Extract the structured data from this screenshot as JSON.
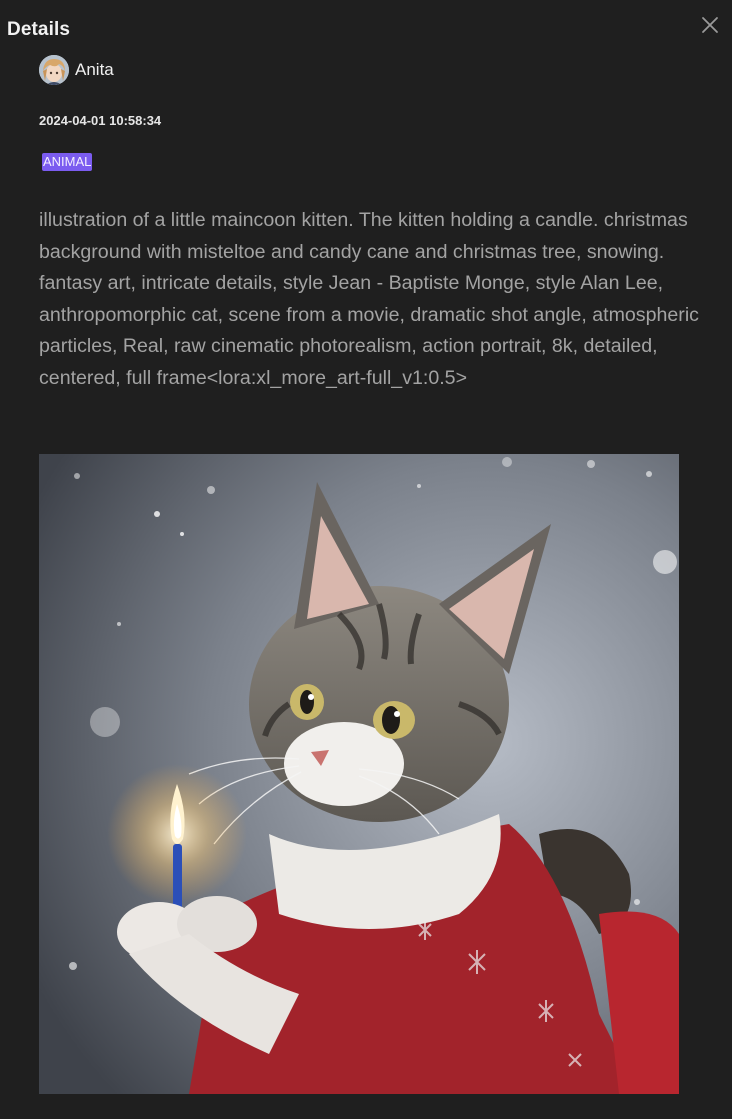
{
  "header": {
    "title": "Details"
  },
  "icons": {
    "close": "close-icon",
    "avatar": "avatar-anime-character"
  },
  "author": {
    "name": "Anita"
  },
  "timestamp": "2024-04-01 10:58:34",
  "tag": {
    "label": "ANIMAL",
    "color": "#7b5cf0"
  },
  "prompt": "illustration of a little maincoon kitten. The kitten holding a candle. christmas background with misteltoe and candy cane and christmas tree, snowing. fantasy art, intricate details, style Jean - Baptiste Monge, style Alan Lee, anthropomorphic cat, scene from a movie, dramatic shot angle, atmospheric particles, Real, raw cinematic photorealism, action portrait, 8k, detailed, centered, full frame<lora:xl_more_art-full_v1:0.5>",
  "colors": {
    "background": "#1f1f1f",
    "prompt_text": "#a3a3a3"
  }
}
